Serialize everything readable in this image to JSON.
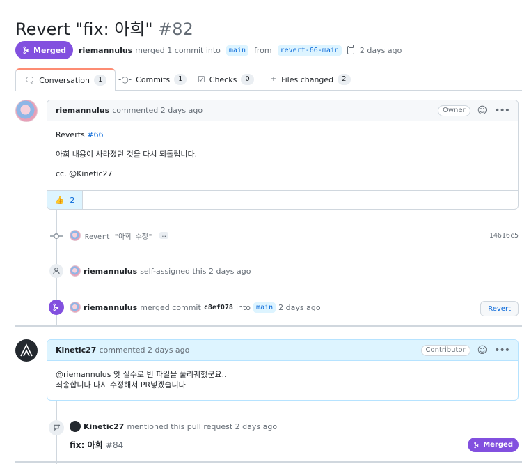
{
  "pr": {
    "title": "Revert \"fix: 아희\"",
    "number": "#82",
    "state": "Merged",
    "author": "riemannulus",
    "merge_text": "merged 1 commit into",
    "base_branch": "main",
    "from_text": "from",
    "head_branch": "revert-66-main",
    "time": "2 days ago"
  },
  "tabs": [
    {
      "label": "Conversation",
      "count": "1"
    },
    {
      "label": "Commits",
      "count": "1"
    },
    {
      "label": "Checks",
      "count": "0"
    },
    {
      "label": "Files changed",
      "count": "2"
    }
  ],
  "comment1": {
    "author": "riemannulus",
    "action": "commented 2 days ago",
    "role": "Owner",
    "line1_prefix": "Reverts ",
    "line1_link": "#66",
    "line2": "아희 내용이 사라졌던 것을 다시 되돌립니다.",
    "line3": "cc. @Kinetic27",
    "reaction": "👍",
    "reaction_count": "2"
  },
  "commit_event": {
    "message": "Revert \"아희 수정\"",
    "ellipsis": "…",
    "sha": "14616c5"
  },
  "assign_event": {
    "author": "riemannulus",
    "text": "self-assigned this 2 days ago"
  },
  "merge_event": {
    "author": "riemannulus",
    "text1": "merged commit",
    "sha": "c8ef078",
    "text2": "into",
    "branch": "main",
    "time": "2 days ago",
    "button": "Revert"
  },
  "comment2": {
    "author": "Kinetic27",
    "action": "commented 2 days ago",
    "role": "Contributor",
    "line1": "@riemannulus 앗 실수로 빈 파일을 풀리퀘했군요..",
    "line2": "죄송합니다 다시 수정해서 PR넣겠습니다"
  },
  "mention_event": {
    "author": "Kinetic27",
    "text": "mentioned this pull request 2 days ago",
    "pr_title": "fix: 아희",
    "pr_number": "#84",
    "badge": "Merged"
  },
  "colors": {
    "merged": "#8250df",
    "link": "#0969da",
    "border": "#d0d7de",
    "tab_accent": "#fd8c73"
  }
}
